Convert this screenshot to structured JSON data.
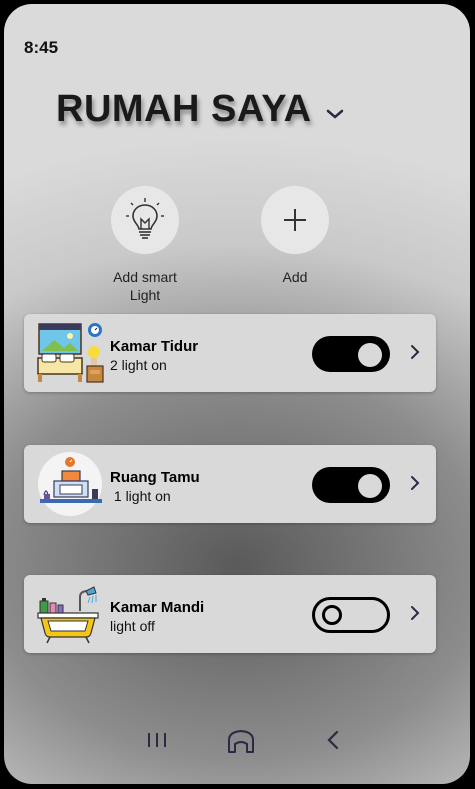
{
  "status_bar": {
    "time": "8:45"
  },
  "header": {
    "title": "RUMAH SAYA",
    "dropdown_icon": "chevron-down-icon"
  },
  "quick_actions": [
    {
      "label": "Add smart Light",
      "icon": "lightbulb-icon"
    },
    {
      "label": "Add",
      "icon": "plus-icon"
    }
  ],
  "rooms": [
    {
      "name": "Kamar Tidur",
      "status": "2 light on",
      "toggle": "on",
      "icon": "bedroom-icon"
    },
    {
      "name": "Ruang Tamu",
      "status": " 1 light on",
      "toggle": "on",
      "icon": "living-room-icon"
    },
    {
      "name": "Kamar Mandi",
      "status": "light off",
      "toggle": "off",
      "icon": "bathroom-icon"
    }
  ],
  "nav_bar": {
    "items": [
      {
        "icon": "recent-apps-icon"
      },
      {
        "icon": "home-icon"
      },
      {
        "icon": "back-icon"
      }
    ]
  }
}
